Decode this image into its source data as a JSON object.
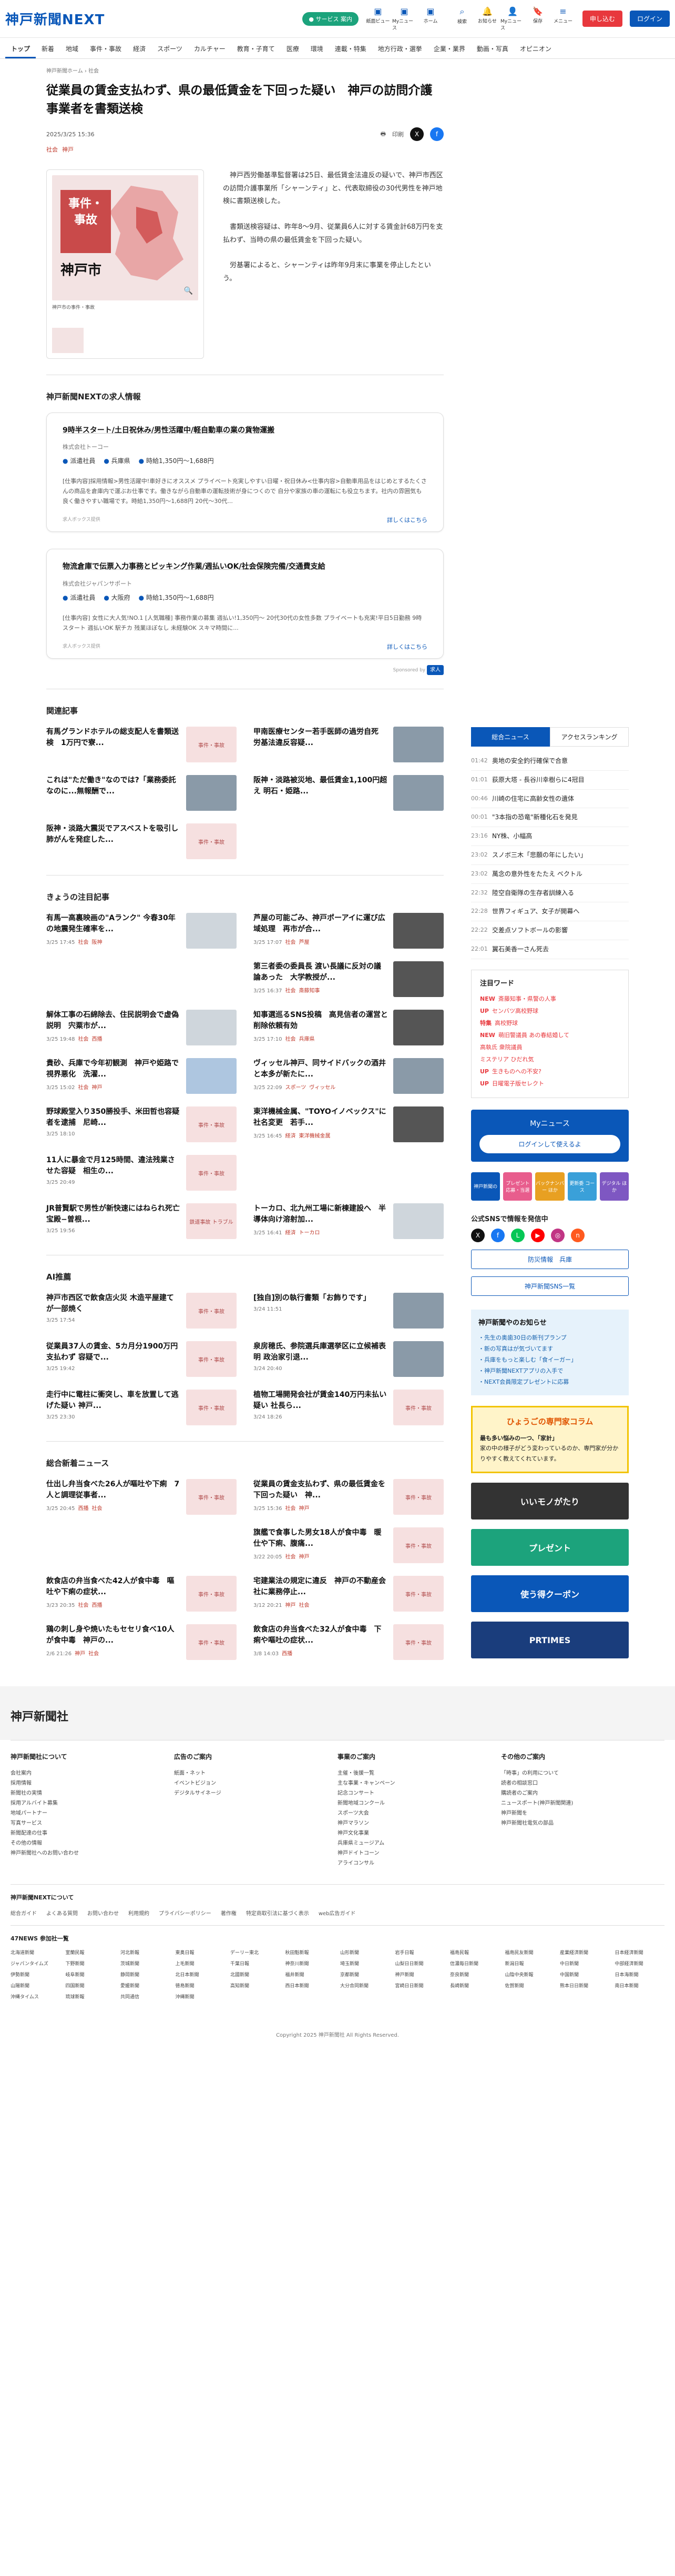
{
  "header": {
    "logo": "神戸新聞NEXT",
    "service": "● サービス 案内",
    "icons": [
      {
        "icon": "search-icon",
        "label": "検索"
      },
      {
        "icon": "bell-icon",
        "label": "お知らせ"
      },
      {
        "icon": "user-icon",
        "label": "Myニュース"
      },
      {
        "icon": "bookmark-icon",
        "label": "保存"
      },
      {
        "icon": "menu-icon",
        "label": "メニュー"
      }
    ],
    "hicons_left": [
      {
        "icon": "newspaper-icon",
        "label": "紙面ビュー"
      },
      {
        "icon": "star-icon",
        "label": "Myニュース"
      },
      {
        "icon": "home-icon",
        "label": "ホーム"
      }
    ],
    "subscribe": "申し込む",
    "login": "ログイン"
  },
  "nav": [
    "トップ",
    "新着",
    "地域",
    "事件・事故",
    "経済",
    "スポーツ",
    "カルチャー",
    "教育・子育て",
    "医療",
    "環境",
    "連載・特集",
    "地方行政・選挙",
    "企業・業界",
    "動画・写真",
    "オピニオン"
  ],
  "breadcrumb": "神戸新聞ホーム › 社会",
  "article": {
    "title": "従業員の賃金支払わず、県の最低賃金を下回った疑い　神戸の訪問介護事業者を書類送検",
    "date": "2025/3/25 15:36",
    "tags": [
      "社会",
      "神戸"
    ],
    "print": "印刷",
    "img_label": "事件・事故",
    "img_city": "神戸市",
    "caption": "神戸市の事件・事故",
    "body": [
      "神戸西労働基準監督署は25日、最低賃金法違反の疑いで、神戸市西区の訪問介護事業所「シャーンティ」と、代表取締役の30代男性を神戸地検に書類送検した。",
      "書類送検容疑は、昨年8～9月、従業員6人に対する賃金計68万円を支払わず、当時の県の最低賃金を下回った疑い。",
      "労基署によると、シャーンティは昨年9月末に事業を停止したという。"
    ]
  },
  "jobs": {
    "title": "神戸新聞NEXTの求人情報",
    "items": [
      {
        "title": "9時半スタート/土日祝休み/男性活躍中/軽自動車の業の貨物運搬",
        "company": "株式会社トーコー",
        "type": "派遣社員",
        "place": "兵庫県",
        "wage": "時給1,350円〜1,688円",
        "desc": "[仕事内容]採用情報>男性活躍中!車好きにオススメ プライベート充実しやすい日曜・祝日休み<仕事内容>自動車用品をはじめとするたくさんの商品を倉庫内で運ぶお仕事です。働きながら自動車の運転技術が身につくので 自分や家族の車の運転にも役立ちます。社内の雰囲気も良く働きやすい職場です。時給1,350円〜1,688円 20代〜30代...",
        "date": "求人ボックス提供",
        "more": "詳しくはこちら"
      },
      {
        "title": "物流倉庫で伝票入力事務とピッキング作業/週払いOK/社会保険完備/交通費支給",
        "company": "株式会社ジャパンサポート",
        "type": "派遣社員",
        "place": "大阪府",
        "wage": "時給1,350円〜1,688円",
        "desc": "[仕事内容] 女性に大人気!NO.1 [人気職種] 事務作業の募集 週払い!1,350円〜 20代30代の女性多数 プライベートも充実!平日5日勤務 9時スタート 週払いOK 駅チカ 残業ほぼなし 未経験OK スキマ時間に...",
        "date": "求人ボックス提供",
        "more": "詳しくはこちら"
      }
    ],
    "sponsor": "Sponsored by"
  },
  "related": {
    "title": "関連記事",
    "items": [
      {
        "t": "有馬グランドホテルの総支配人を書類送検　1万円で寮...",
        "thumb": "事件・事故"
      },
      {
        "t": "甲南医療センター若手医師の過労自死　労基法違反容疑...",
        "thumb": "photo"
      },
      {
        "t": "これは\"ただ働き\"なのでは?「業務委託なのに...無報酬で...",
        "thumb": "photo"
      },
      {
        "t": "阪神・淡路被災地、最低賃金1,100円超え 明石・姫路...",
        "thumb": "photo"
      },
      {
        "t": "阪神・淡路大震災でアスベストを吸引し肺がんを発症した...",
        "thumb": "事件・事故"
      }
    ]
  },
  "today": {
    "title": "きょうの注目記事",
    "items": [
      {
        "t": "有馬一高裏映画の\"Aランク\" 今春30年の地震発生確率を...",
        "d": "3/25 17:45",
        "tag": "社会",
        "tag2": "阪神",
        "thumb": "grey"
      },
      {
        "t": "芦屋の可能ごみ、神戸ポーアイに運び広域処理　再市が合...",
        "d": "3/25 17:07",
        "tag": "社会",
        "tag2": "芦屋",
        "thumb": "dark"
      },
      {
        "t": "",
        "d": "",
        "tag": "",
        "tag2": "",
        "thumb": ""
      },
      {
        "t": "第三者委の委員長 渡い長議に反対の議論あった　大学教授が...",
        "d": "3/25 16:37",
        "tag": "社会",
        "tag2": "斎藤知事",
        "thumb": "dark"
      },
      {
        "t": "解体工事の石綿除去、住民説明会で虚偽説明　宍粟市が...",
        "d": "3/25 19:48",
        "tag": "社会",
        "tag2": "西播",
        "thumb": "grey"
      },
      {
        "t": "知事選巡るSNS投稿　高見信者の運営と削除依頼有効",
        "d": "3/25 17:10",
        "tag": "社会",
        "tag2": "兵庫県",
        "thumb": "dark"
      },
      {
        "t": "貴砂、兵庫で今年初観測　神戸や姫路で視界悪化　洗濯...",
        "d": "3/25 15:02",
        "tag": "社会",
        "tag2": "神戸",
        "thumb": "blue"
      },
      {
        "t": "ヴィッセル神戸、同サイドバックの酒井と本多が新たに...",
        "d": "3/25 22:09",
        "tag": "スポーツ",
        "tag2": "ヴィッセル",
        "thumb": "photo"
      },
      {
        "t": "野球殿堂入り350勝投手、米田哲也容疑者を逮捕　尼崎...",
        "d": "3/25 18:10",
        "tag": "",
        "tag2": "",
        "thumb": "事件・事故"
      },
      {
        "t": "東洋機械金属、\"TOYOイノベックス\"に社名変更　若手...",
        "d": "3/25 16:45",
        "tag": "経済",
        "tag2": "東洋機械金属",
        "thumb": "dark"
      },
      {
        "t": "11人に暴金で月125時間、違法残業させた容疑　相生の...",
        "d": "3/25 20:49",
        "tag": "",
        "tag2": "",
        "thumb": "事件・事故"
      },
      {
        "t": "",
        "d": "",
        "tag": "",
        "tag2": "",
        "thumb": ""
      },
      {
        "t": "JR普賢駅で男性が新快速にはねられ死亡　宝殿−曽根...",
        "d": "3/25 19:56",
        "tag": "",
        "tag2": "",
        "thumb": "鉄道事故 トラブル"
      },
      {
        "t": "トーカロ、北九州工場に新棟建設へ　半導体向け溶射加...",
        "d": "3/25 16:41",
        "tag": "経済",
        "tag2": "トーカロ",
        "thumb": "grey"
      }
    ]
  },
  "ai": {
    "title": "AI推薦",
    "items": [
      {
        "t": "神戸市西区で飲食店火災 木造平屋建てが一部焼く",
        "d": "3/25 17:54",
        "thumb": "事件・事故"
      },
      {
        "t": "[独自]別の執行書類「お飾りです」",
        "d": "3/24 11:51",
        "thumb": "photo"
      },
      {
        "t": "従業員37人の賃金、5カ月分1900万円支払わず 容疑で...",
        "d": "3/25 19:42",
        "thumb": "事件・事故"
      },
      {
        "t": "泉房穂氏、参院選兵庫選挙区に立候補表明 政治家引退...",
        "d": "3/24 20:40",
        "thumb": "photo"
      },
      {
        "t": "走行中に電柱に衝突し、車を放置して逃げた疑い 神戸...",
        "d": "3/25 23:30",
        "thumb": "事件・事故"
      },
      {
        "t": "植物工場開発会社が賃金140万円未払い疑い 社長ら...",
        "d": "3/24 18:26",
        "thumb": "事件・事故"
      }
    ]
  },
  "general": {
    "title": "総合新着ニュース",
    "items": [
      {
        "t": "仕出し弁当食べた26人が嘔吐や下痢　7人と調理従事者...",
        "d": "3/25 20:45",
        "tag": "西播",
        "tag2": "社会",
        "thumb": "事件・事故"
      },
      {
        "t": "従業員の賃金支払わず、県の最低賃金を下回った疑い　神...",
        "d": "3/25 15:36",
        "tag": "社会",
        "tag2": "神戸",
        "thumb": "事件・事故"
      },
      {
        "t": "",
        "d": "",
        "tag": "",
        "tag2": "",
        "thumb": ""
      },
      {
        "t": "旗艦で食事した男女18人が食中毒　暖仕や下痢、腹痛...",
        "d": "3/22 20:05",
        "tag": "社会",
        "tag2": "神戸",
        "thumb": "事件・事故"
      },
      {
        "t": "飲食店の弁当食べた42人が食中毒　嘔吐や下痢の症状...",
        "d": "3/23 20:35",
        "tag": "社会",
        "tag2": "西播",
        "thumb": "事件・事故"
      },
      {
        "t": "宅建業法の規定に違反　神戸の不動産会社に業務停止...",
        "d": "3/12 20:21",
        "tag": "神戸",
        "tag2": "社会",
        "thumb": "事件・事故"
      },
      {
        "t": "鶏の刺し身や焼いたもセセリ食べ10人が食中毒　神戸の...",
        "d": "2/6 21:26",
        "tag": "神戸",
        "tag2": "社会",
        "thumb": "事件・事故"
      },
      {
        "t": "飲食店の弁当食べた32人が食中毒　下痢や嘔吐の症状...",
        "d": "3/8 14:03",
        "tag": "西播",
        "tag2": "",
        "thumb": "事件・事故"
      }
    ]
  },
  "side": {
    "tabs": [
      "総合ニュース",
      "アクセスランキング"
    ],
    "ranking": [
      {
        "time": "01:42",
        "t": "奥地の安全釣行確保で合意"
      },
      {
        "time": "01:01",
        "t": "荻原大塔 - 長谷川幸樹らに4冠目"
      },
      {
        "time": "00:46",
        "t": "川崎の住宅に高齢女性の遺体"
      },
      {
        "time": "00:01",
        "t": "\"3本指の恐竜\"新種化石を発見"
      },
      {
        "time": "23:16",
        "t": "NY株、小幅高"
      },
      {
        "time": "23:02",
        "t": "スノボ三木「悲願の年にしたい」"
      },
      {
        "time": "23:02",
        "t": "萬念の意外性をたたえ ベクトル"
      },
      {
        "time": "22:32",
        "t": "陸空自衛隊の生存者訓練入る"
      },
      {
        "time": "22:28",
        "t": "世界フィギュア、女子が開幕へ"
      },
      {
        "time": "22:22",
        "t": "交差点ソフトボールの影響"
      },
      {
        "time": "22:01",
        "t": "翼石美香一さん死去"
      }
    ],
    "kw_title": "注目ワード",
    "keywords": [
      {
        "mark": "NEW",
        "t": "斎藤知事・県警の人事"
      },
      {
        "mark": "UP",
        "t": "センバツ高校野球"
      },
      {
        "mark": "特集",
        "t": "高校野球"
      },
      {
        "mark": "NEW",
        "t": "萌旧警議員 あの春結婚して"
      },
      {
        "mark": "",
        "t": "高執氏 衆院議員"
      },
      {
        "mark": "",
        "t": "ミステリア ひだれ気"
      },
      {
        "mark": "UP",
        "t": "生きものへの不安?"
      },
      {
        "mark": "UP",
        "t": "日曜電子版セレクト"
      }
    ],
    "mynews": "Myニュース",
    "mynews_btn": "ログインして使えるよ",
    "tiles": [
      "神戸新聞の",
      "プレゼント 応募・当選",
      "バックナンバー ほか",
      "更新委 コース",
      "デジタル ほか"
    ],
    "sns_title": "公式SNSで情報を発信中",
    "follow1": "防災情報　兵庫",
    "follow2": "神戸新聞SNS一覧",
    "next_title": "神戸新聞やのお知らせ",
    "next_lines": [
      "・先生の奥歯30日の新刊プランプ",
      "・新の写真はが気づいてます",
      "・兵庫をもっと楽しむ「食イーガー」",
      "・神戸新聞NEXTアプリの入手で",
      "・NEXT会員限定プレゼントに応募"
    ],
    "col_title": "ひょうごの専門家コラム",
    "col_sub": "最も多い悩みの一つ、「家計」",
    "col_text": "家の中の様子がどう変わっているのか、専門家が分かりやすく教えてくれています。",
    "banners": [
      "いいモノがたり",
      "プレゼント",
      "使う得クーポン",
      "PRTIMES"
    ]
  },
  "footer": {
    "logo": "神戸新聞社",
    "cols": [
      {
        "h": "神戸新聞社について",
        "items": [
          "会社案内",
          "採用情報",
          "新聞社の実情",
          "採用アルバイト募集",
          "地域パートナー",
          "写真サービス",
          "新聞配達の仕事",
          "その他の情報",
          "神戸新聞社へのお問い合わせ"
        ]
      },
      {
        "h": "広告のご案内",
        "items": [
          "紙面・ネット",
          "イベントビジョン",
          "デジタルサイネージ"
        ]
      },
      {
        "h": "事業のご案内",
        "items": [
          "主催・後援一覧",
          "主な事業・キャンペーン",
          "記念コンサート",
          "新聞地域コンクール",
          "スポーツ大会",
          "神戸マラソン",
          "神戸文化事業",
          "兵庫県ミュージアム",
          "神戸ドイトコーン",
          "アライコンサル"
        ]
      },
      {
        "h": "その他のご案内",
        "items": [
          "「時事」の利用について",
          "読者の相談窓口",
          "購読者のご案内",
          "ニュースポート(神戸新聞関連)",
          "神戸新聞を",
          "神戸新聞社電気の部品"
        ]
      }
    ],
    "bar_title": "神戸新聞NEXTについて",
    "links": [
      "総合ガイド",
      "よくある質問",
      "お問い合わせ",
      "利用規約",
      "プライバシーポリシー",
      "著作権",
      "特定商取引法に基づく表示",
      "web広告ガイド"
    ],
    "members_title": "47NEWS 参加社一覧",
    "members": [
      "北海道新聞",
      "室蘭民報",
      "河北新報",
      "東奥日報",
      "デーリー東北",
      "秋田魁新報",
      "山形新聞",
      "岩手日報",
      "福島民報",
      "福島民友新聞",
      "産業経済新聞",
      "日本経済新聞",
      "ジャパンタイムズ",
      "下野新聞",
      "茨城新聞",
      "上毛新聞",
      "千葉日報",
      "神奈川新聞",
      "埼玉新聞",
      "山梨日日新聞",
      "信濃毎日新聞",
      "新潟日報",
      "中日新聞",
      "中部経済新聞",
      "伊勢新聞",
      "岐阜新聞",
      "静岡新聞",
      "北日本新聞",
      "北國新聞",
      "福井新聞",
      "京都新聞",
      "神戸新聞",
      "奈良新聞",
      "山陰中央新報",
      "中国新聞",
      "日本海新聞",
      "山陽新聞",
      "四国新聞",
      "愛媛新聞",
      "徳島新聞",
      "高知新聞",
      "西日本新聞",
      "大分合同新聞",
      "宮崎日日新聞",
      "長崎新聞",
      "佐賀新聞",
      "熊本日日新聞",
      "南日本新聞",
      "沖縄タイムス",
      "琉球新報",
      "共同通信",
      "沖縄新聞"
    ],
    "copyright": "Copyright 2025 神戸新聞社 All Rights Reserved."
  }
}
